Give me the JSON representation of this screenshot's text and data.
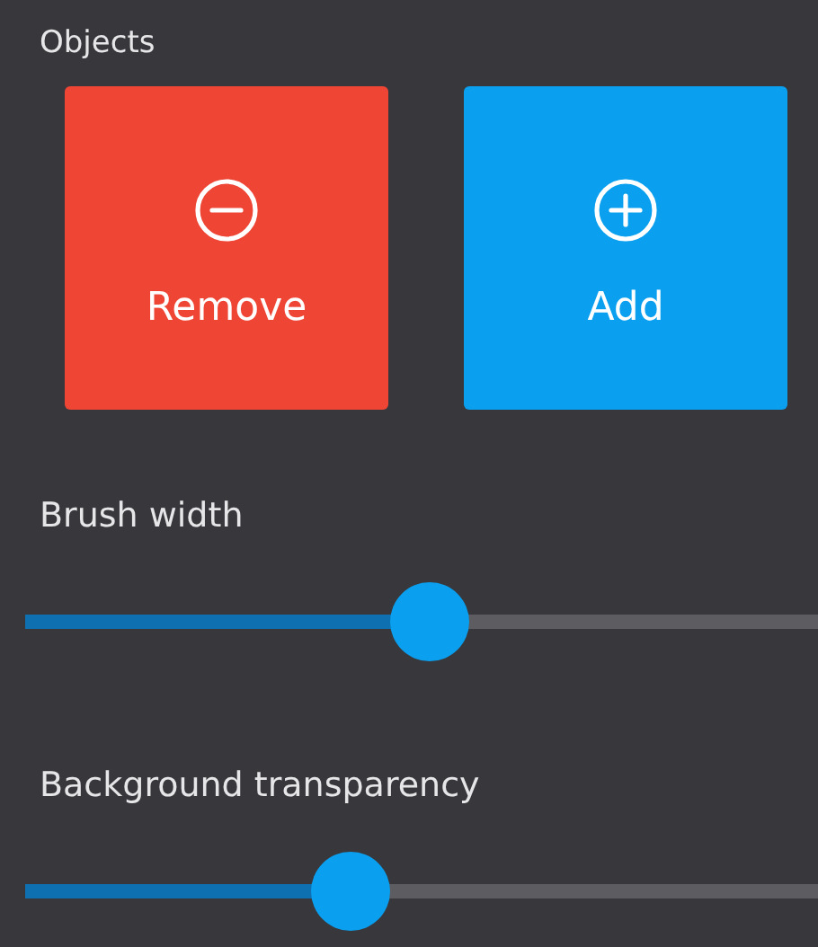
{
  "section_title": "Objects",
  "buttons": [
    {
      "kind": "remove",
      "label": "Remove"
    },
    {
      "kind": "add",
      "label": "Add"
    }
  ],
  "sliders": [
    {
      "label": "Brush width",
      "level": 0.51
    },
    {
      "label": "Background transparency",
      "level": 0.41
    }
  ]
}
